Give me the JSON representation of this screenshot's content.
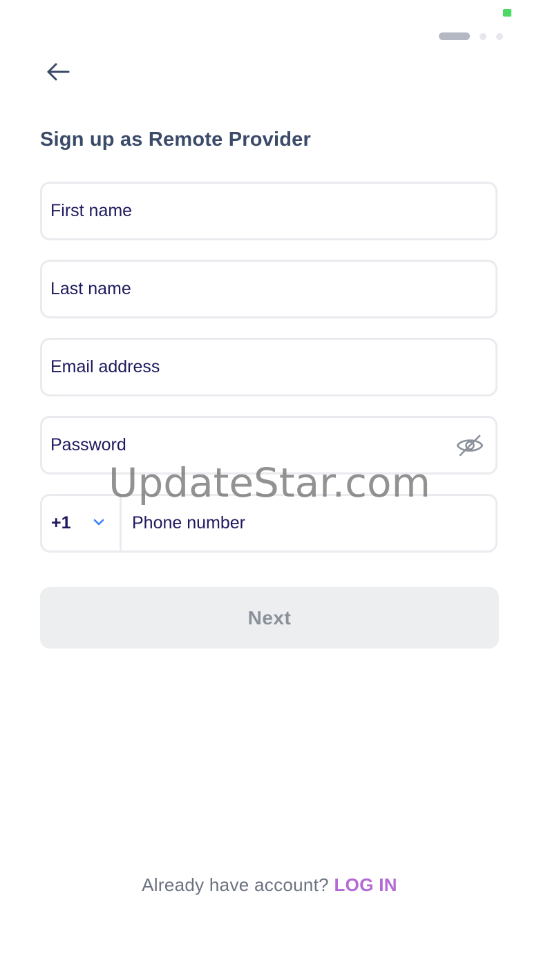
{
  "header": {
    "title": "Sign up as Remote Provider"
  },
  "form": {
    "first_name": {
      "placeholder": "First name"
    },
    "last_name": {
      "placeholder": "Last name"
    },
    "email": {
      "placeholder": "Email address"
    },
    "password": {
      "placeholder": "Password"
    },
    "phone": {
      "country_code": "+1",
      "placeholder": "Phone number"
    },
    "next_label": "Next"
  },
  "footer": {
    "prompt": "Already have account?",
    "login_label": "LOG IN"
  },
  "watermark": "UpdateStar.com",
  "icons": {
    "back": "arrow-left-icon",
    "visibility": "eye-off-icon",
    "dropdown": "chevron-down-icon"
  },
  "colors": {
    "title": "#3a4a68",
    "input_text": "#1e1a5e",
    "accent_link": "#b36ad6",
    "chevron": "#3b82f6",
    "button_bg": "#eceef0",
    "button_text": "#8b919a"
  },
  "stepper": {
    "current_step": 1,
    "total_steps": 3
  }
}
